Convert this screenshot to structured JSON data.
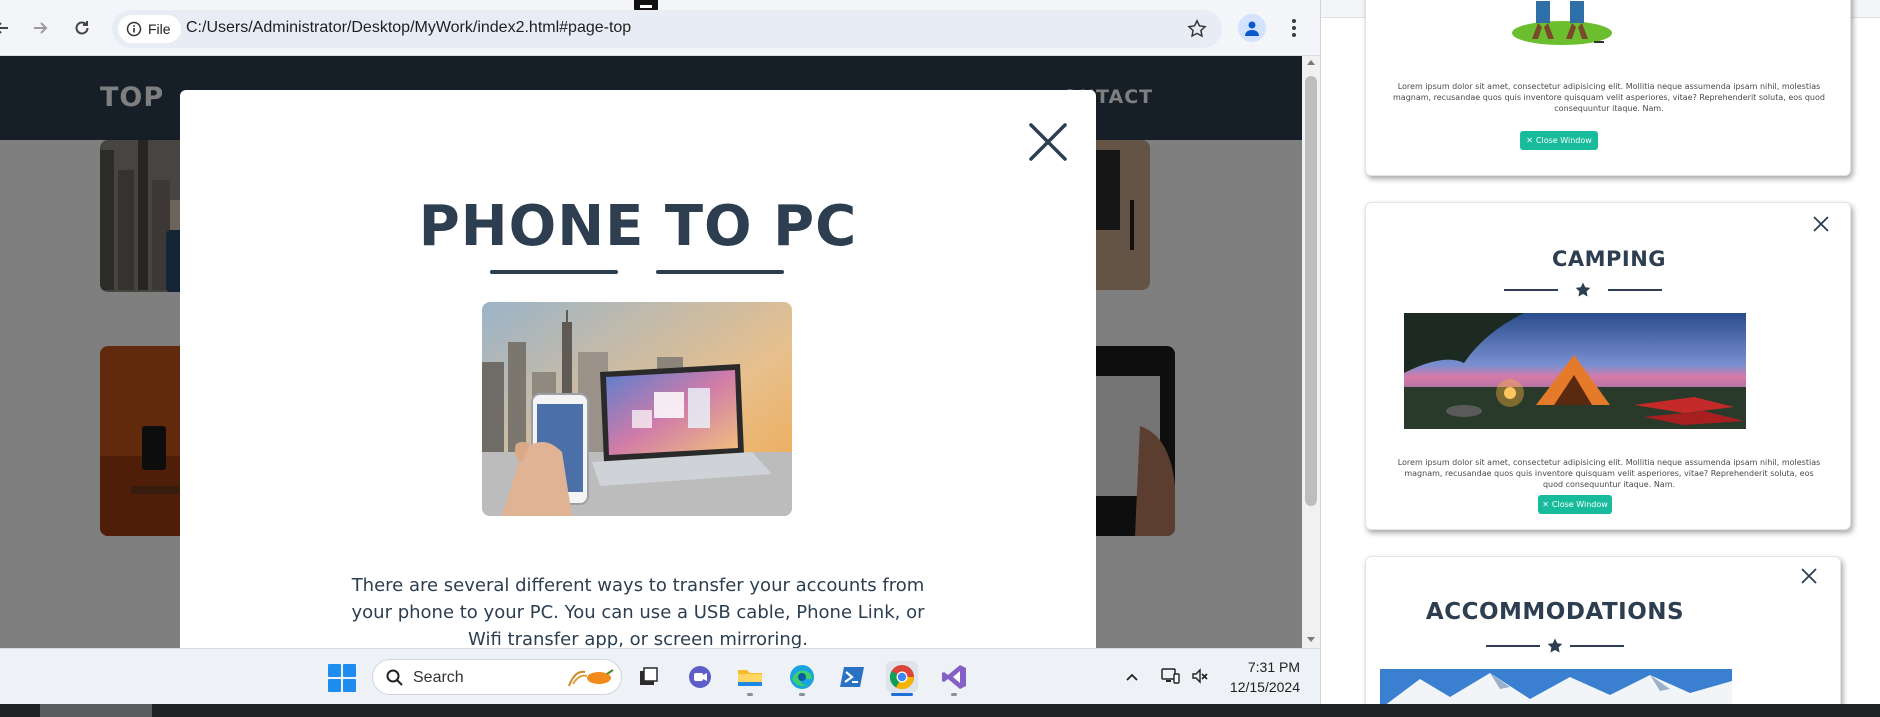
{
  "browser": {
    "file_chip_label": "File",
    "url": "C:/Users/Administrator/Desktop/MyWork/index2.html#page-top"
  },
  "site": {
    "brand": "TOP",
    "nav_contact": "ONTACT"
  },
  "modal": {
    "title": "PHONE TO PC",
    "body": "There are several different ways to transfer your accounts from your phone to your PC. You can use a USB cable, Phone Link, or Wifi transfer app, or screen mirroring."
  },
  "taskbar": {
    "search_label": "Search",
    "time": "7:31 PM",
    "date": "12/15/2024"
  },
  "right_panel": {
    "card1": {
      "text": "Lorem ipsum dolor sit amet, consectetur adipisicing elit. Mollitia neque assumenda ipsam nihil, molestias magnam, recusandae quos quis inventore quisquam velit asperiores, vitae? Reprehenderit soluta, eos quod consequuntur itaque. Nam.",
      "button": "Close Window"
    },
    "card2": {
      "title": "CAMPING",
      "text": "Lorem ipsum dolor sit amet, consectetur adipisicing elit. Mollitia neque assumenda ipsam nihil, molestias magnam, recusandae quos quis inventore quisquam velit asperiores, vitae? Reprehenderit soluta, eos quod consequuntur itaque. Nam.",
      "button": "Close Window"
    },
    "card3": {
      "title": "ACCOMMODATIONS"
    }
  },
  "colors": {
    "primary": "#2c3e50",
    "accent": "#18bc9c",
    "windows_blue": "#1f8df0"
  }
}
